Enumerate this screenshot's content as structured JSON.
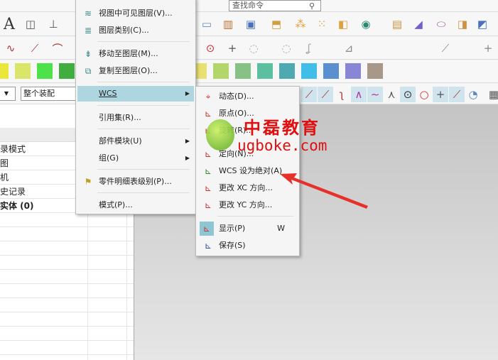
{
  "toolbar": {
    "command_search_placeholder": "查找命令",
    "filter_value": "整个装配",
    "text_icon": "A",
    "palette": [
      "#ebe63a",
      "#d9e66a",
      "#4ee24a",
      "#3fae3f",
      "#444444",
      "#969696",
      "#d987b4",
      "#e07870",
      "#eeb070",
      "#e8e070",
      "#b3d66a",
      "#86c286",
      "#5cbfa0",
      "#4eaab0",
      "#40bde8",
      "#5a90d0",
      "#8a86d6",
      "#a89888"
    ]
  },
  "left_panel": {
    "rows": [
      "录模式",
      "图",
      "机",
      "史记录",
      "实体 (0)"
    ]
  },
  "main_menu": {
    "items": [
      {
        "label": "视图中可见图层(V)...",
        "icon": "layer-visible-icon"
      },
      {
        "label": "图层类别(C)...",
        "icon": "layer-category-icon"
      },
      {
        "label": "移动至图层(M)...",
        "icon": "move-to-layer-icon"
      },
      {
        "label": "复制至图层(O)...",
        "icon": "copy-to-layer-icon"
      },
      {
        "label": "WCS",
        "submenu": true,
        "highlighted": true
      },
      {
        "label": "引用集(R)..."
      },
      {
        "label": "部件模块(U)",
        "submenu": true
      },
      {
        "label": "组(G)",
        "submenu": true
      },
      {
        "label": "零件明细表级别(P)...",
        "icon": "parts-list-icon"
      },
      {
        "label": "模式(P)..."
      }
    ]
  },
  "wcs_submenu": {
    "items": [
      {
        "label": "动态(D)...",
        "icon": "wcs-dynamic-icon"
      },
      {
        "label": "原点(O)...",
        "icon": "wcs-origin-icon"
      },
      {
        "label": "旋转(R)...",
        "icon": "wcs-rotate-icon"
      },
      {
        "label": "定向(N)...",
        "icon": "wcs-orient-icon"
      },
      {
        "label": "WCS 设为绝对(A)",
        "icon": "wcs-absolute-icon"
      },
      {
        "label": "更改 XC 方向...",
        "icon": "change-xc-icon"
      },
      {
        "label": "更改 YC 方向...",
        "icon": "change-yc-icon"
      },
      {
        "label": "显示(P)",
        "shortcut": "W",
        "icon": "wcs-display-icon"
      },
      {
        "label": "保存(S)",
        "icon": "wcs-save-icon"
      }
    ]
  },
  "watermark": {
    "title": "中磊教育",
    "url": "ugboke.com",
    "color": "#e01010"
  }
}
